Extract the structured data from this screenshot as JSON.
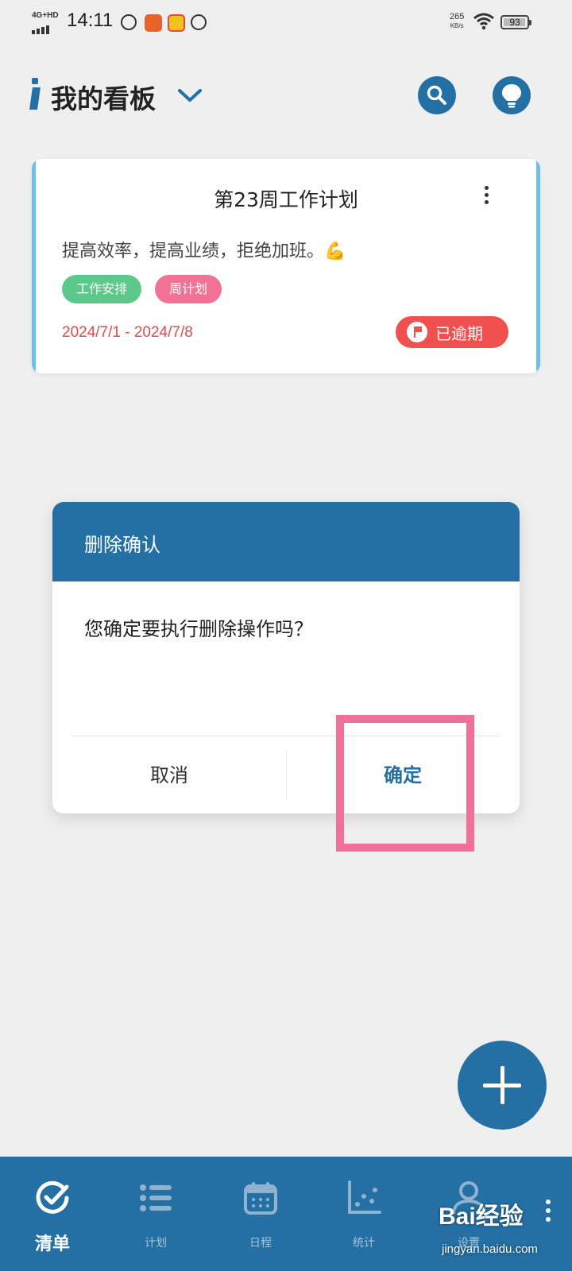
{
  "status_bar": {
    "network": "4G+HD",
    "time": "14:11",
    "speed_value": "265",
    "speed_unit": "KB/s",
    "battery": "93"
  },
  "header": {
    "title": "我的看板",
    "icons": [
      "search-icon",
      "lightbulb-icon",
      "chevron-down-icon"
    ]
  },
  "card": {
    "title": "第23周工作计划",
    "description": "提高效率，提高业绩，拒绝加班。",
    "emoji": "💪",
    "tags": [
      "工作安排",
      "周计划"
    ],
    "date_range": "2024/7/1 - 2024/7/8",
    "status": "已逾期",
    "colors": {
      "accent": "#6cc0e8",
      "overdue": "#f05050",
      "tag_green": "#5cc98a",
      "tag_pink": "#f27296"
    }
  },
  "dialog": {
    "title": "删除确认",
    "message": "您确定要执行删除操作吗？",
    "cancel_label": "取消",
    "confirm_label": "确定"
  },
  "bottom_nav": {
    "items": [
      {
        "label": "清单",
        "icon": "check-circle-icon",
        "active": true
      },
      {
        "label": "计划",
        "icon": "list-icon",
        "active": false
      },
      {
        "label": "日程",
        "icon": "calendar-icon",
        "active": false
      },
      {
        "label": "统计",
        "icon": "scatter-chart-icon",
        "active": false
      },
      {
        "label": "设置",
        "icon": "user-icon",
        "active": false
      }
    ]
  },
  "watermark": {
    "main": "Bai经验",
    "sub": "jingyan.baidu.com"
  },
  "theme": {
    "primary": "#246fa3",
    "highlight": "#f07099"
  }
}
